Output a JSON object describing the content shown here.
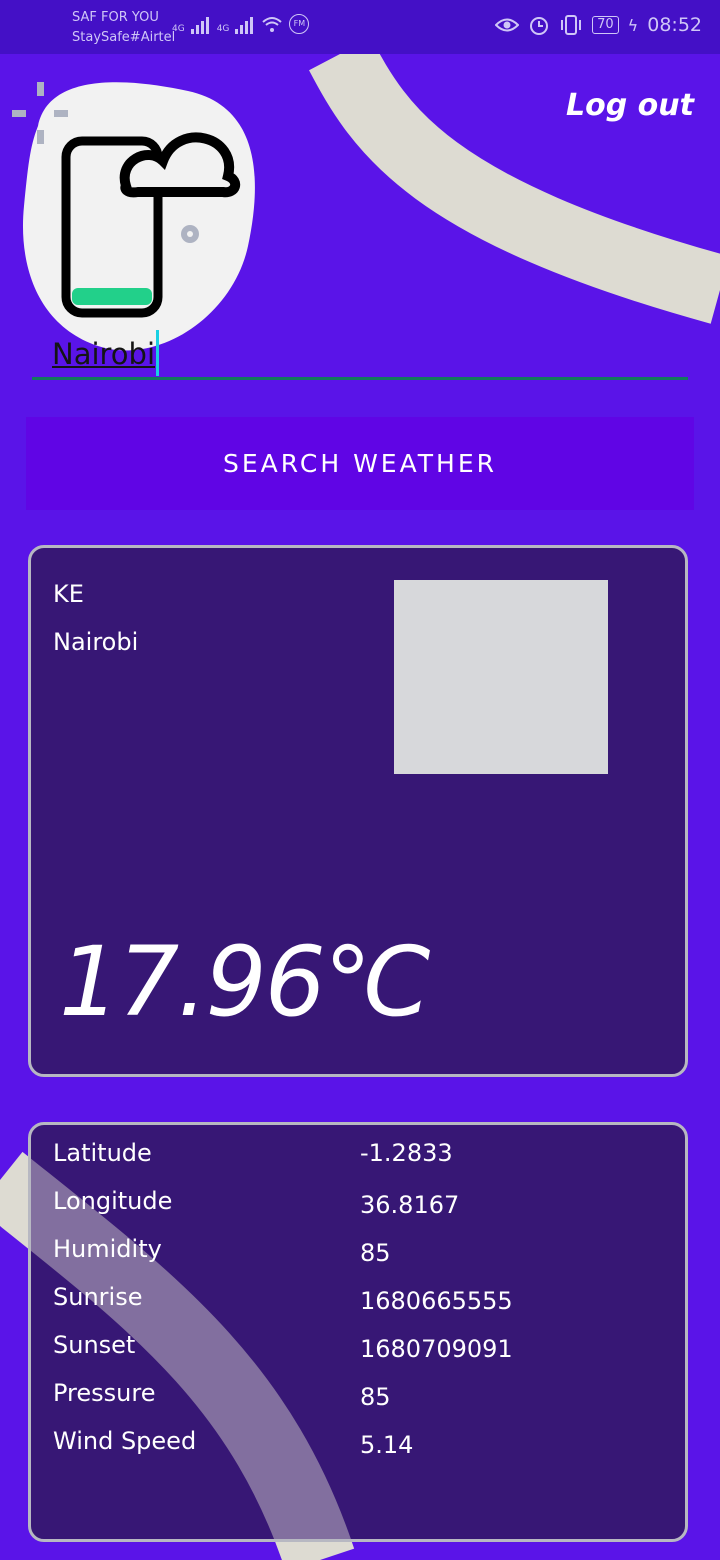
{
  "status_bar": {
    "carrier_line1": "SAF FOR YOU",
    "carrier_line2": "StaySafe#Airtel",
    "network1": "4G",
    "network2": "4G",
    "fm_label": "FM",
    "battery": "70",
    "time": "08:52"
  },
  "header": {
    "logout_label": "Log out"
  },
  "search": {
    "city_value": "Nairobi",
    "button_label": "SEARCH WEATHER"
  },
  "weather": {
    "country": "KE",
    "city": "Nairobi",
    "temperature": "17.96℃"
  },
  "details": [
    {
      "label": "Latitude",
      "value": "-1.2833"
    },
    {
      "label": "Longitude",
      "value": "36.8167"
    },
    {
      "label": "Humidity",
      "value": "85"
    },
    {
      "label": "Sunrise",
      "value": "1680665555"
    },
    {
      "label": "Sunset",
      "value": "1680709091"
    },
    {
      "label": "Pressure",
      "value": "85"
    },
    {
      "label": "Wind Speed",
      "value": "5.14"
    }
  ],
  "colors": {
    "background": "#5a14e8",
    "card": "#371775",
    "button": "#6005e5",
    "decor": "#dddbd2",
    "input_underline": "#13795e"
  },
  "icons": [
    "eye-icon",
    "alarm-icon",
    "vibrate-icon",
    "battery-icon",
    "charging-icon",
    "wifi-icon",
    "signal-icon",
    "phone-cloud-logo"
  ]
}
